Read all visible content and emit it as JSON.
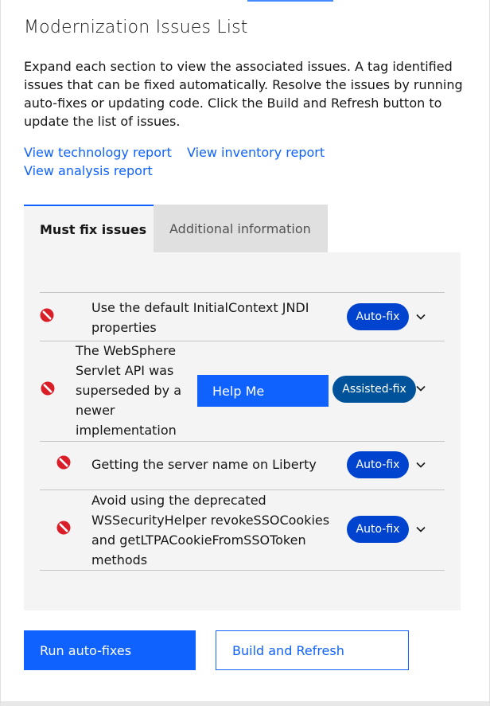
{
  "header": {
    "title": "Modernization Issues List",
    "description": "Expand each section to view the associated issues. A tag identified issues that can be fixed automatically. Resolve the issues by running auto-fixes or updating code. Click the Build and Refresh button to update the list of issues."
  },
  "links": {
    "technology": "View technology report",
    "inventory": "View inventory report",
    "analysis": "View analysis report"
  },
  "tabs": [
    {
      "label": "Must fix issues",
      "selected": true
    },
    {
      "label": "Additional information",
      "selected": false
    }
  ],
  "issues": [
    {
      "title": "Use the default InitialContext JNDI properties",
      "tag": "Auto-fix",
      "severity_icon": "error-icon"
    },
    {
      "title": "The WebSphere Servlet API was superseded by a newer implementation",
      "tag": "Assisted-fix",
      "severity_icon": "error-icon",
      "help_label": "Help Me"
    },
    {
      "title": "Getting the server name on Liberty",
      "tag": "Auto-fix",
      "severity_icon": "error-icon"
    },
    {
      "title": "Avoid using the deprecated WSSecurityHelper revokeSSOCookies and getLTPACookieFromSSOToken methods",
      "tag": "Auto-fix",
      "severity_icon": "error-icon"
    }
  ],
  "actions": {
    "run_autofixes": "Run auto-fixes",
    "build_refresh": "Build and Refresh"
  },
  "colors": {
    "primary": "#0f62fe",
    "autofix_tag": "#0043ce",
    "assisted_tag": "#00539a",
    "error_icon": "#da1e28",
    "panel_bg": "#f4f4f4"
  }
}
